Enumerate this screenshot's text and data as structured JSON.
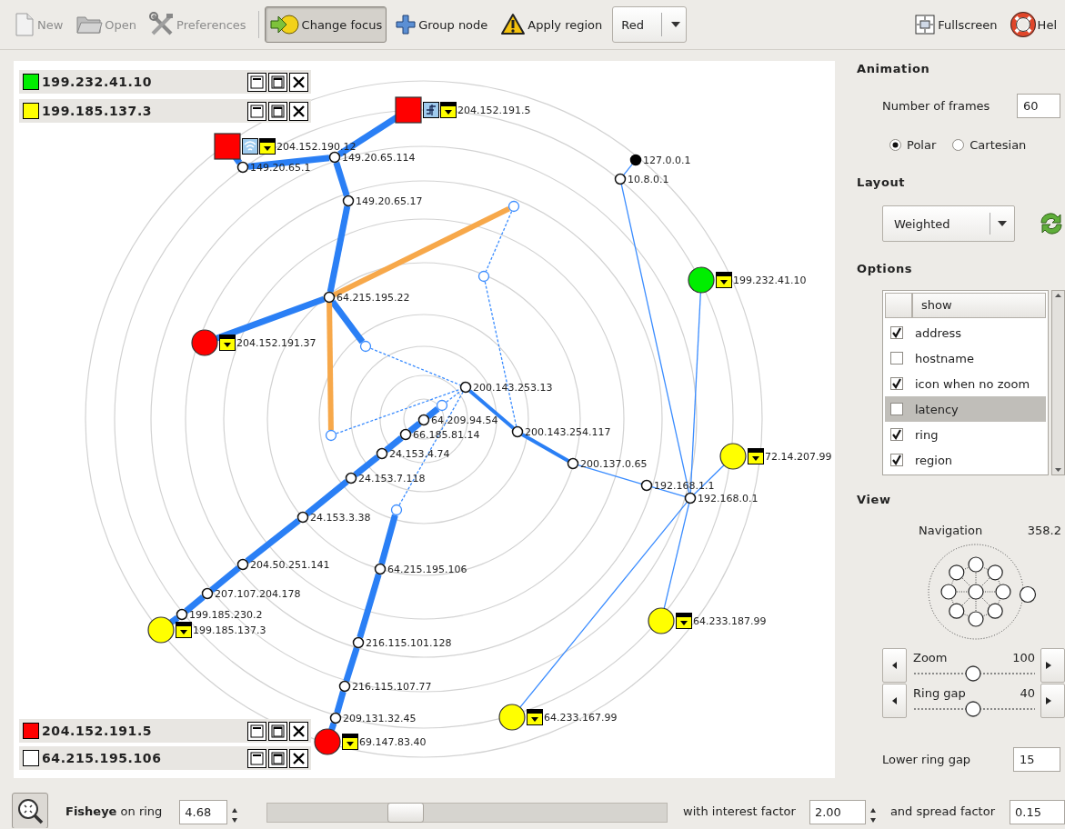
{
  "toolbar": {
    "items": [
      {
        "kind": "new",
        "label": "New",
        "disabled": true,
        "pressed": false
      },
      {
        "kind": "open",
        "label": "Open",
        "disabled": true,
        "pressed": false
      },
      {
        "kind": "preferences",
        "label": "Preferences",
        "disabled": true,
        "pressed": false
      },
      {
        "kind": "change_focus",
        "label": "Change focus",
        "disabled": false,
        "pressed": true
      },
      {
        "kind": "group",
        "label": "Group node",
        "disabled": false,
        "pressed": false
      },
      {
        "kind": "apply_region",
        "label": "Apply region",
        "disabled": false,
        "pressed": false
      }
    ],
    "region_choice": "Red",
    "right_items": [
      {
        "kind": "fullscreen",
        "label": "Fullscreen",
        "disabled": false,
        "pressed": false
      },
      {
        "kind": "help",
        "label": "Hel",
        "disabled": false,
        "pressed": false
      }
    ]
  },
  "graph": {
    "host_panels": [
      {
        "label": "199.232.41.10",
        "color": "#00ee00"
      },
      {
        "label": "199.185.137.3",
        "color": "#ffff00"
      },
      {
        "label": "204.152.191.5",
        "color": "#ff0000"
      },
      {
        "label": "64.215.195.106",
        "color": "#ffffff"
      }
    ],
    "nodes": [
      {
        "kind": "square",
        "color": "#ff0000",
        "label": "204.152.191.5",
        "icons": [
          {
            "kind": "router"
          },
          {
            "kind": "lock"
          }
        ]
      },
      {
        "kind": "square",
        "color": "#ff0000",
        "label": "204.152.190.12",
        "icons": [
          {
            "kind": "wireless"
          },
          {
            "kind": "lock"
          }
        ]
      },
      {
        "kind": "point",
        "label": "149.20.65.1"
      },
      {
        "kind": "point",
        "label": "149.20.65.114"
      },
      {
        "kind": "point",
        "label": "149.20.65.17"
      },
      {
        "kind": "point",
        "label": "64.215.195.22"
      },
      {
        "kind": "circle",
        "color": "#ff0000",
        "label": "204.152.191.37",
        "icons": [
          {
            "kind": "lock"
          }
        ]
      },
      {
        "kind": "ghost"
      },
      {
        "kind": "ghost"
      },
      {
        "kind": "ghost"
      },
      {
        "kind": "ghost"
      },
      {
        "kind": "point",
        "label": "200.143.253.13"
      },
      {
        "kind": "ghost"
      },
      {
        "kind": "point",
        "label": "64.209.94.54"
      },
      {
        "kind": "point",
        "label": "66.185.81.14"
      },
      {
        "kind": "point",
        "label": "24.153.4.74"
      },
      {
        "kind": "point",
        "label": "24.153.7.118"
      },
      {
        "kind": "point",
        "label": "24.153.3.38"
      },
      {
        "kind": "point",
        "label": "204.50.251.141"
      },
      {
        "kind": "point",
        "label": "207.107.204.178"
      },
      {
        "kind": "point",
        "label": "199.185.230.2"
      },
      {
        "kind": "circle",
        "color": "#ffff00",
        "label": "199.185.137.3",
        "icons": [
          {
            "kind": "lock"
          }
        ]
      },
      {
        "kind": "ghost"
      },
      {
        "kind": "point",
        "label": "64.215.195.106"
      },
      {
        "kind": "point",
        "label": "216.115.101.128"
      },
      {
        "kind": "point",
        "label": "216.115.107.77"
      },
      {
        "kind": "point",
        "label": "209.131.32.45"
      },
      {
        "kind": "circle",
        "color": "#ff0000",
        "label": "69.147.83.40",
        "icons": [
          {
            "kind": "lock"
          }
        ]
      },
      {
        "kind": "point",
        "label": "200.143.254.117"
      },
      {
        "kind": "point",
        "label": "200.137.0.65"
      },
      {
        "kind": "point",
        "label": "192.168.1.1"
      },
      {
        "kind": "point",
        "label": "192.168.0.1"
      },
      {
        "kind": "point",
        "color": "#000000",
        "label": "127.0.0.1"
      },
      {
        "kind": "point",
        "label": "10.8.0.1"
      },
      {
        "kind": "circle",
        "color": "#00ee00",
        "label": "199.232.41.10",
        "icons": [
          {
            "kind": "lock"
          }
        ]
      },
      {
        "kind": "circle",
        "color": "#ffff00",
        "label": "72.14.207.99",
        "icons": [
          {
            "kind": "lock"
          }
        ]
      },
      {
        "kind": "circle",
        "color": "#ffff00",
        "label": "64.233.187.99",
        "icons": [
          {
            "kind": "lock"
          }
        ]
      },
      {
        "kind": "circle",
        "color": "#ffff00",
        "label": "64.233.167.99",
        "icons": [
          {
            "kind": "lock"
          }
        ]
      }
    ]
  },
  "animation": {
    "title": "Animation",
    "frames_label": "Number of frames",
    "frames": "60",
    "modes": [
      {
        "label": "Polar",
        "selected": true
      },
      {
        "label": "Cartesian",
        "selected": false
      }
    ]
  },
  "layout": {
    "title": "Layout",
    "algorithm": "Weighted"
  },
  "options": {
    "title": "Options",
    "header": "show",
    "items": [
      {
        "label": "address",
        "checked": true,
        "selected": false
      },
      {
        "label": "hostname",
        "checked": false,
        "selected": false
      },
      {
        "label": "icon when no zoom",
        "checked": true,
        "selected": false
      },
      {
        "label": "latency",
        "checked": false,
        "selected": true
      },
      {
        "label": "ring",
        "checked": true,
        "selected": false
      },
      {
        "label": "region",
        "checked": true,
        "selected": false
      }
    ]
  },
  "view": {
    "title": "View",
    "navigation_label": "Navigation",
    "navigation_value": "358.2",
    "sliders": [
      {
        "label": "Zoom",
        "value": "100",
        "level": 0.49
      },
      {
        "label": "Ring gap",
        "value": "40",
        "level": 0.49
      }
    ],
    "lower_ring_gap_label": "Lower ring gap",
    "lower_ring_gap": "15"
  },
  "fisheye": {
    "label": "**Fisheye** on ring",
    "ring": "4.68",
    "level": 0.33,
    "interest_label": "with interest factor",
    "interest": "2.00",
    "spread_label": "and spread factor",
    "spread": "0.15"
  }
}
